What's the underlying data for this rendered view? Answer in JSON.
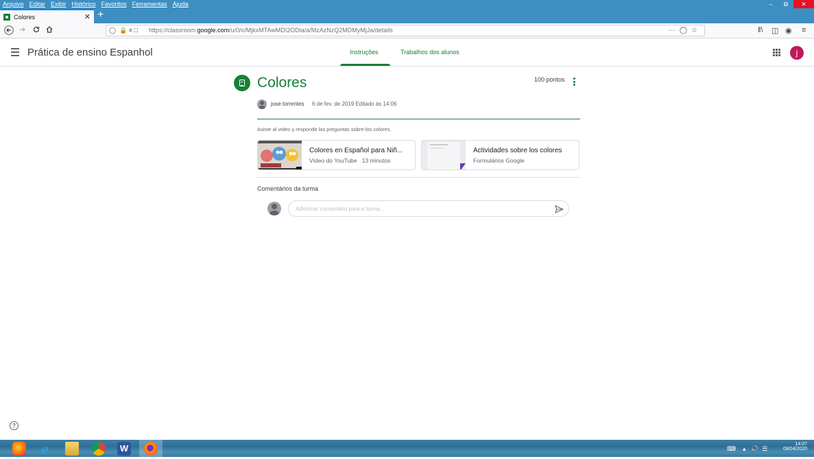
{
  "browser": {
    "menu": [
      "Arquivo",
      "Editar",
      "Exibir",
      "Histórico",
      "Favoritos",
      "Ferramentas",
      "Ajuda"
    ],
    "tab_title": "Colores",
    "url_prefix": "https://classroom.",
    "url_domain": "google.com",
    "url_path": "/u/0/c/MjkxMTAwMDI2ODla/a/MzAzNzQ2MDMyMjJa/details"
  },
  "header": {
    "class_title": "Prática de ensino Espanhol",
    "tabs": [
      "Instruções",
      "Trabalhos dos alunos"
    ],
    "avatar_letter": "j",
    "avatar_color": "#c2185b",
    "accent_color": "#188038"
  },
  "assignment": {
    "title": "Colores",
    "points": "100 pontos",
    "author": "jose torrentes",
    "date": "6 de fev. de 2019 Editado às 14:06",
    "description": "Asiste al video y responde las preguntas sobre los colores.",
    "attachments": [
      {
        "title": "Colores en Español para Niñ...",
        "type": "Vídeo do YouTube",
        "duration": "13 minutos"
      },
      {
        "title": "Actividades sobre los colores",
        "type": "Formulários Google"
      }
    ]
  },
  "comments": {
    "heading": "Comentários da turma",
    "placeholder": "Adicionar comentário para a turma..."
  },
  "taskbar": {
    "time": "14:07",
    "date": "08/04/2020"
  },
  "icons": [
    "back-icon",
    "forward-icon",
    "reload-icon",
    "home-icon",
    "shield-icon",
    "lock-icon",
    "library-icon",
    "account-icon",
    "menu-icon",
    "apps-icon",
    "more-vert-icon",
    "send-icon",
    "help-icon"
  ]
}
